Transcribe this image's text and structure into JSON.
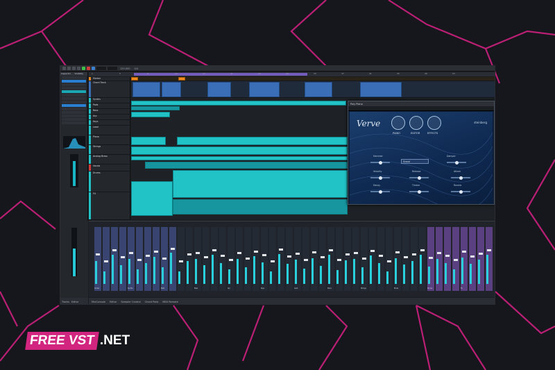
{
  "transport": {
    "tempo": "120.000",
    "signature": "4/4",
    "buttons": [
      "go-to-start",
      "rewind",
      "forward",
      "stop",
      "play",
      "record",
      "cycle"
    ]
  },
  "inspector": {
    "tabs": [
      "Inspector",
      "Visibility"
    ],
    "sections": [
      "Chords",
      "Inserts",
      "Strips",
      "Equalizers",
      "Sends",
      "Channel"
    ]
  },
  "ruler": {
    "ticks": [
      "1",
      "5",
      "9",
      "13",
      "17",
      "21",
      "25",
      "29",
      "33",
      "37",
      "41",
      "45",
      "49",
      "53"
    ]
  },
  "tracks": [
    {
      "name": "Marker",
      "color": "#e98a21"
    },
    {
      "name": "Chord Track",
      "color": "#3a6fb8"
    },
    {
      "name": "Synths",
      "color": "#22c3c7"
    },
    {
      "name": "Pads",
      "color": "#22c3c7"
    },
    {
      "name": "Bass",
      "color": "#22c3c7"
    },
    {
      "name": "Arp",
      "color": "#22c3c7"
    },
    {
      "name": "Keys",
      "color": "#22c3c7"
    },
    {
      "name": "Lead",
      "color": "#22c3c7"
    },
    {
      "name": "Piano",
      "color": "#22c3c7"
    },
    {
      "name": "Strings",
      "color": "#22c3c7"
    },
    {
      "name": "Analog Brass",
      "color": "#22c3c7"
    },
    {
      "name": "Vocals",
      "color": "#d23a3a"
    },
    {
      "name": "Drums",
      "color": "#22c3c7"
    },
    {
      "name": "FX",
      "color": "#22c3c7"
    }
  ],
  "plugin": {
    "window_title": "Poly Piano",
    "vendor": "steinberg",
    "brand": "Verve",
    "tabs": [
      "PIANO",
      "EDITOR",
      "EFFECTS"
    ],
    "preset": "Grand",
    "params": [
      "Hammer",
      "Damper",
      "Velocity",
      "Release",
      "Attack",
      "Decay",
      "Timbre",
      "Reverb"
    ]
  },
  "mixer": {
    "strip_labels": [
      "Vocals",
      "Synths",
      "Pads",
      "Bass",
      "Arp",
      "Keys",
      "Lead",
      "Piano",
      "Strings",
      "Brass",
      "Drums",
      "FX",
      "Stereo Out"
    ]
  },
  "bottom_tabs": [
    "MixConsole",
    "Editor",
    "Sampler Control",
    "Chord Pads",
    "MIDI Remote"
  ],
  "left_bottom_tabs": [
    "Tracks",
    "Editor"
  ],
  "watermark": {
    "left": "FREE VST",
    "right": ".NET"
  },
  "colors": {
    "accent_cyan": "#22c3c7",
    "background_dark": "#15171c",
    "neon_magenta": "#c4207a",
    "purple_range": "#7b62c9"
  }
}
